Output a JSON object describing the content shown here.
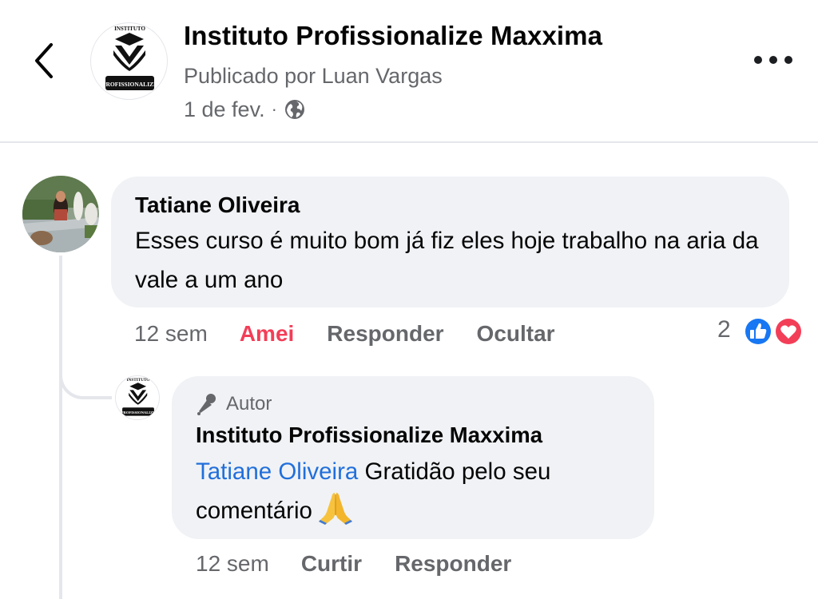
{
  "header": {
    "back_icon": "chevron-left-icon",
    "page_name": "Instituto Profissionalize Maxxima",
    "published_by": "Publicado por Luan Vargas",
    "date": "1 de fev.",
    "separator": "·",
    "privacy_icon": "globe-icon",
    "more_icon": "more-horizontal-icon",
    "logo": {
      "top_text": "INSTITUTO",
      "bottom_text": "PROFISSIONALIZE"
    }
  },
  "comment": {
    "author": "Tatiane Oliveira",
    "text": "Esses curso é muito bom já fiz eles hoje trabalho na aria da vale a um ano",
    "time": "12 sem",
    "reaction_action": "Amei",
    "reply_action": "Responder",
    "hide_action": "Ocultar",
    "reaction_count": "2",
    "reaction_types": [
      "like",
      "love"
    ],
    "reaction_colors": {
      "like": "#1877f2",
      "love": "#f33e58"
    }
  },
  "reply": {
    "badge": "Autor",
    "badge_icon": "microphone-icon",
    "author": "Instituto Profissionalize Maxxima",
    "mention": "Tatiane Oliveira",
    "text": "Gratidão pelo seu comentário",
    "emoji": "🙏",
    "time": "12 sem",
    "like_action": "Curtir",
    "reply_action": "Responder"
  },
  "colors": {
    "text_primary": "#050505",
    "text_secondary": "#65676b",
    "bubble_bg": "#f0f2f5",
    "mention": "#216fdb",
    "love": "#f33e58",
    "like": "#1877f2"
  }
}
